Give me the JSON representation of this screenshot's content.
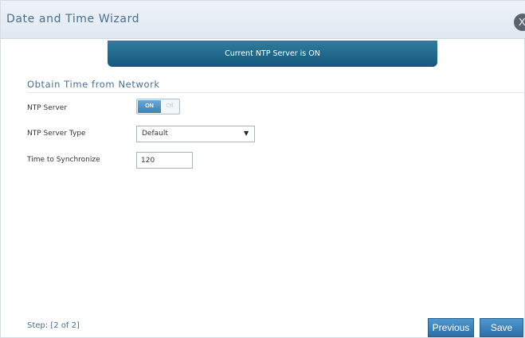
{
  "dialog": {
    "title": "Date and Time Wizard",
    "close_label": "X"
  },
  "banner": {
    "text": "Current NTP Server is ON"
  },
  "section": {
    "title": "Obtain Time from Network"
  },
  "fields": {
    "ntp_server": {
      "label": "NTP Server",
      "on_label": "ON",
      "off_label": "Off",
      "state": "on"
    },
    "ntp_server_type": {
      "label": "NTP Server Type",
      "value": "Default"
    },
    "time_to_synchronize": {
      "label": "Time to Synchronize",
      "value": "120"
    }
  },
  "footer": {
    "step": "Step: [2 of 2]",
    "previous_label": "Previous",
    "save_label": "Save"
  },
  "colors": {
    "banner": "#1f6a8e",
    "accent_text": "#4b6e8c",
    "button": "#3a83bd",
    "toggle_on": "#4f90c7"
  },
  "icons": {
    "close": "close-icon",
    "dropdown": "chevron-down-icon"
  }
}
